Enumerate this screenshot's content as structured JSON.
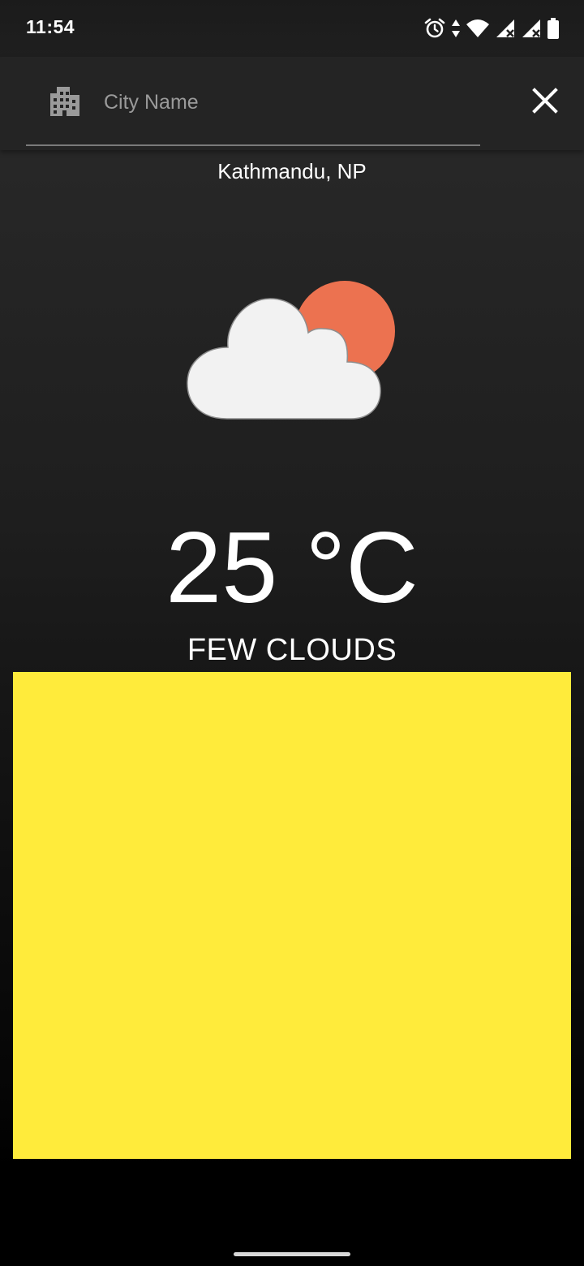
{
  "status_bar": {
    "time": "11:54",
    "icons": [
      "alarm-icon",
      "data-arrows-icon",
      "wifi-icon",
      "cell-signal-icon",
      "cell-signal-icon",
      "battery-icon"
    ],
    "wifi_badge": "4"
  },
  "search": {
    "icon": "city-icon",
    "placeholder": "City Name",
    "value": "",
    "close_icon": "close-icon"
  },
  "weather": {
    "location": "Kathmandu, NP",
    "icon": "partly-cloudy-icon",
    "temperature": "25 °C",
    "condition": "FEW CLOUDS"
  },
  "colors": {
    "sun": "#ec7250",
    "cloud": "#f2f2f2",
    "ad_panel": "#ffeb3b",
    "app_bar": "#242424"
  }
}
